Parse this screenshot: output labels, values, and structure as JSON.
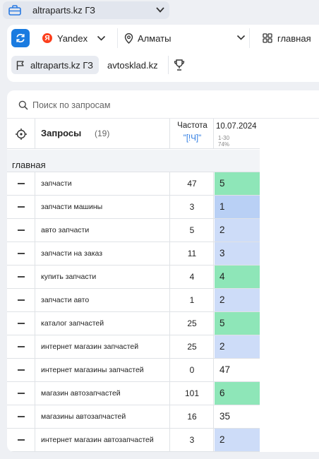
{
  "project": {
    "name": "altraparts.kz ГЗ",
    "icon": "briefcase-icon"
  },
  "toolbar": {
    "search_engine": "Yandex",
    "region": "Алматы",
    "group": "главная"
  },
  "domains": [
    {
      "label": "altraparts.kz ГЗ",
      "active": true
    },
    {
      "label": "avtosklad.kz",
      "active": false
    }
  ],
  "search": {
    "placeholder": "Поиск по запросам",
    "value": ""
  },
  "table": {
    "header": {
      "queries_label": "Запросы",
      "queries_count": "(19)",
      "frequency_label": "Частота",
      "frequency_operator": "\"[!Ч]\"",
      "date_label": "10.07.2024",
      "date_range": "1-30",
      "date_percent": "74%"
    },
    "group_name": "главная",
    "rows": [
      {
        "query": "запчасти",
        "freq": "47",
        "pos": "5",
        "color": "#8ee6b8"
      },
      {
        "query": "запчасти машины",
        "freq": "3",
        "pos": "1",
        "color": "#b9d0f5"
      },
      {
        "query": "авто запчасти",
        "freq": "5",
        "pos": "2",
        "color": "#cddcf8"
      },
      {
        "query": "запчасти на заказ",
        "freq": "11",
        "pos": "3",
        "color": "#cddcf8"
      },
      {
        "query": "купить запчасти",
        "freq": "4",
        "pos": "4",
        "color": "#8ee6b8"
      },
      {
        "query": "запчасти авто",
        "freq": "1",
        "pos": "2",
        "color": "#cddcf8"
      },
      {
        "query": "каталог запчастей",
        "freq": "25",
        "pos": "5",
        "color": "#8ee6b8"
      },
      {
        "query": "интернет магазин запчастей",
        "freq": "25",
        "pos": "2",
        "color": "#cddcf8"
      },
      {
        "query": "интернет магазины запчастей",
        "freq": "0",
        "pos": "47",
        "color": "#ffffff"
      },
      {
        "query": "магазин автозапчастей",
        "freq": "101",
        "pos": "6",
        "color": "#8ee6b8"
      },
      {
        "query": "магазины автозапчастей",
        "freq": "16",
        "pos": "35",
        "color": "#ffffff"
      },
      {
        "query": "интернет магазин автозапчастей",
        "freq": "3",
        "pos": "2",
        "color": "#cddcf8"
      }
    ]
  }
}
